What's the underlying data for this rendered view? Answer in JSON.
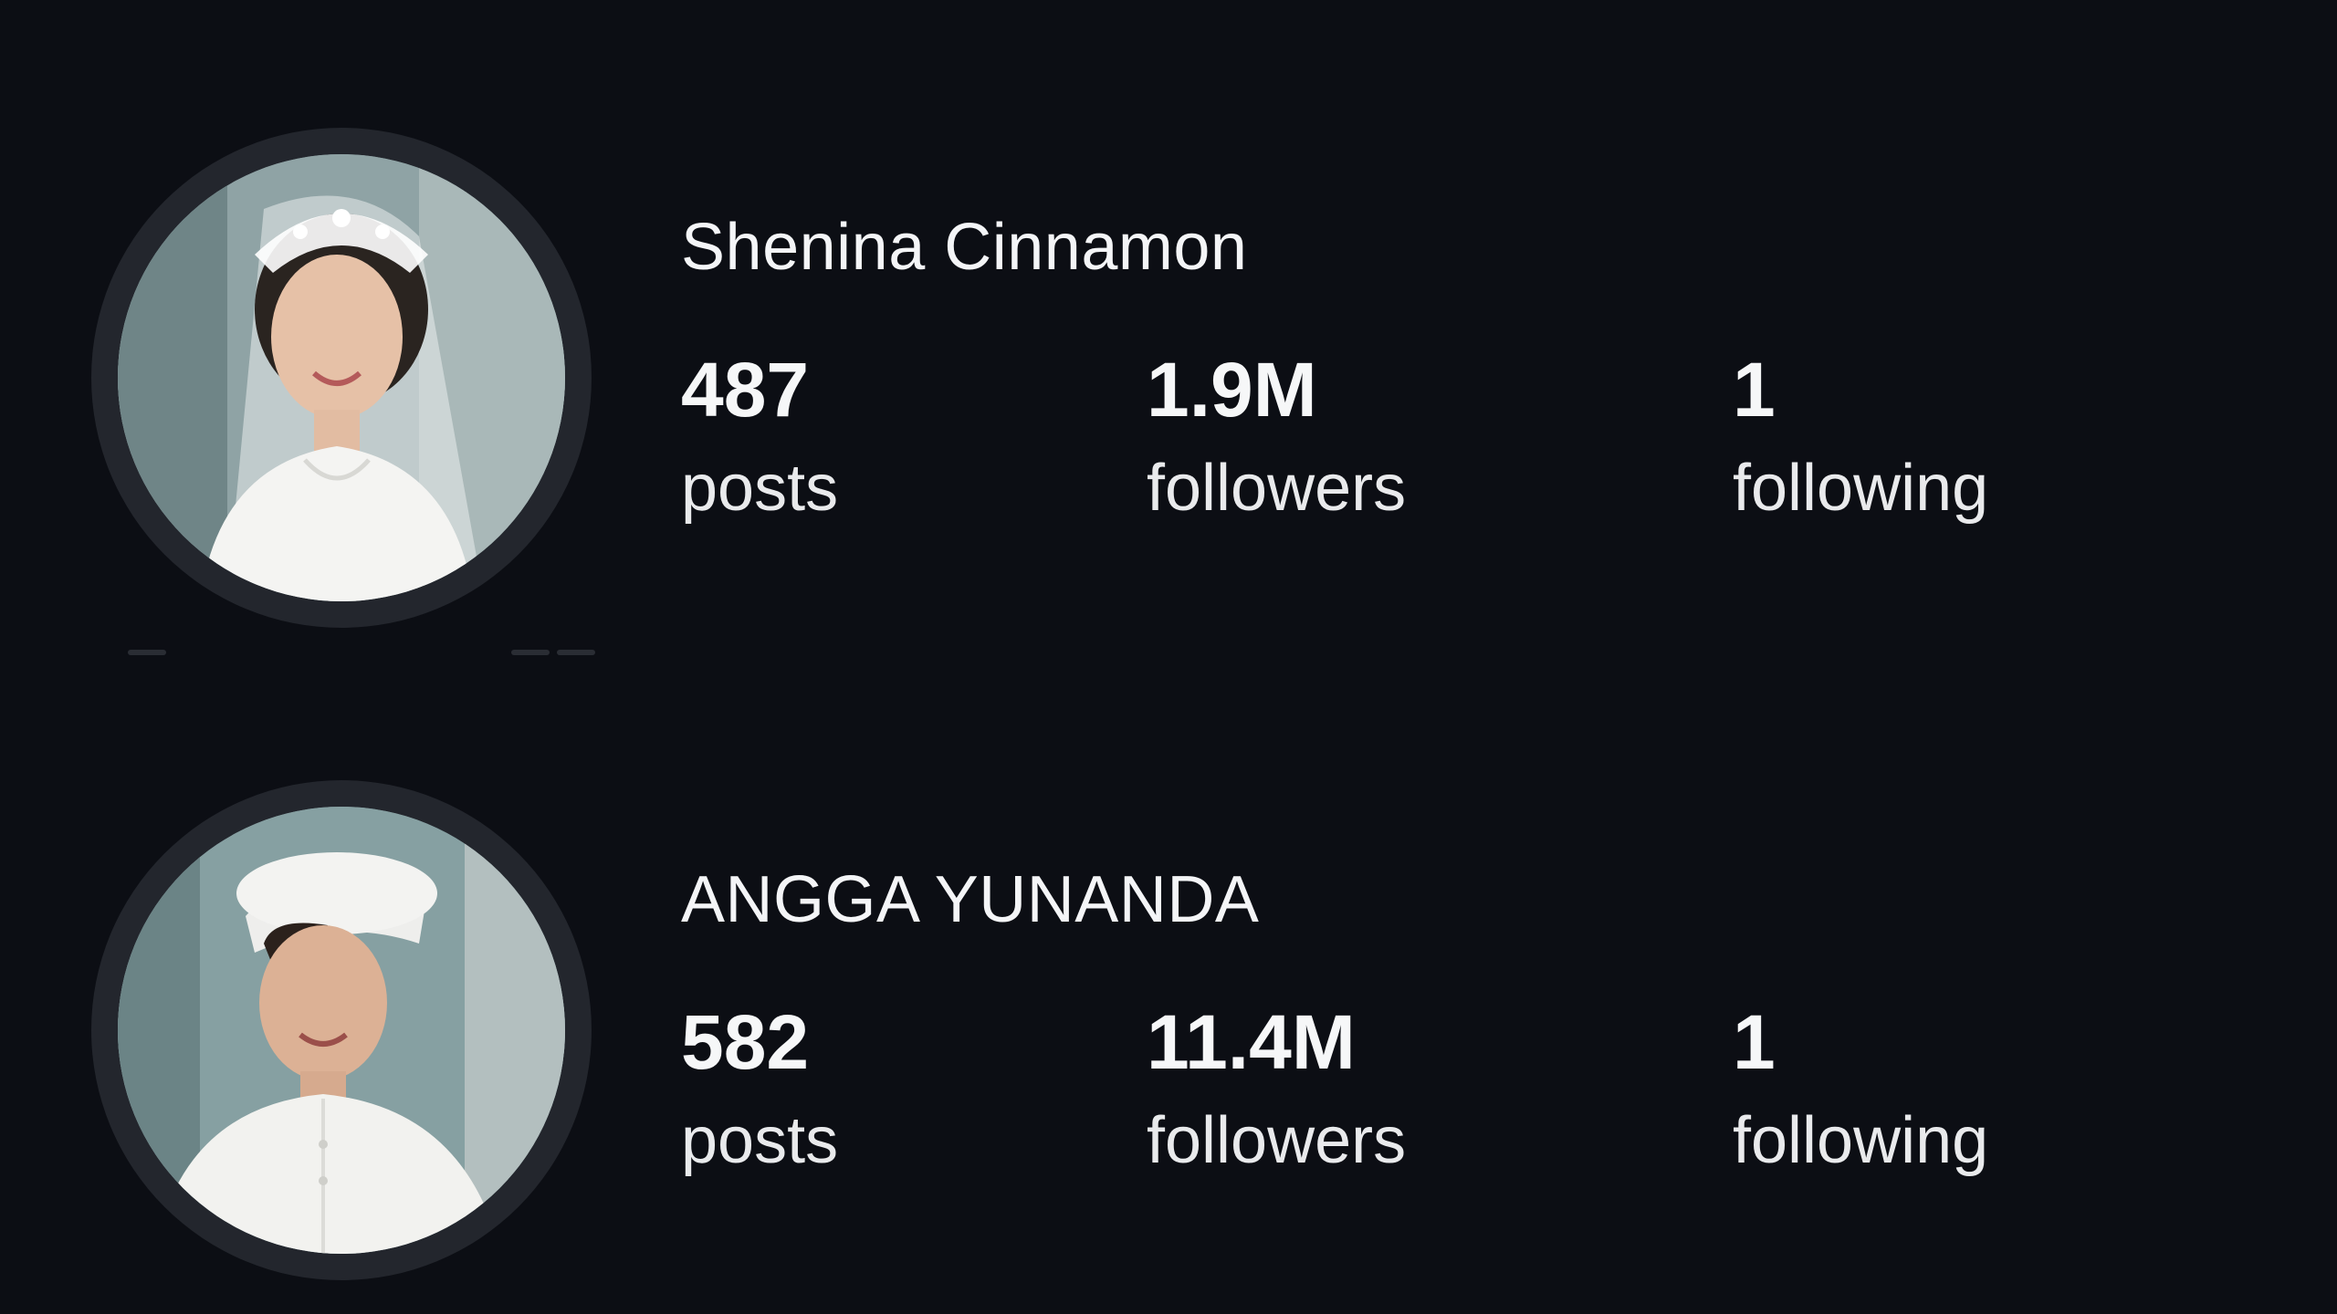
{
  "profiles": [
    {
      "name": "Shenina Cinnamon",
      "avatar_icon": "profile-photo-bride",
      "stats": {
        "posts": {
          "value": "487",
          "label": "posts"
        },
        "followers": {
          "value": "1.9M",
          "label": "followers"
        },
        "following": {
          "value": "1",
          "label": "following"
        }
      }
    },
    {
      "name": "ANGGA YUNANDA",
      "avatar_icon": "profile-photo-groom",
      "stats": {
        "posts": {
          "value": "582",
          "label": "posts"
        },
        "followers": {
          "value": "11.4M",
          "label": "followers"
        },
        "following": {
          "value": "1",
          "label": "following"
        }
      }
    }
  ],
  "colors": {
    "background": "#0c0e14",
    "avatar_ring": "#23262d",
    "text_primary": "#f4f5f7"
  }
}
